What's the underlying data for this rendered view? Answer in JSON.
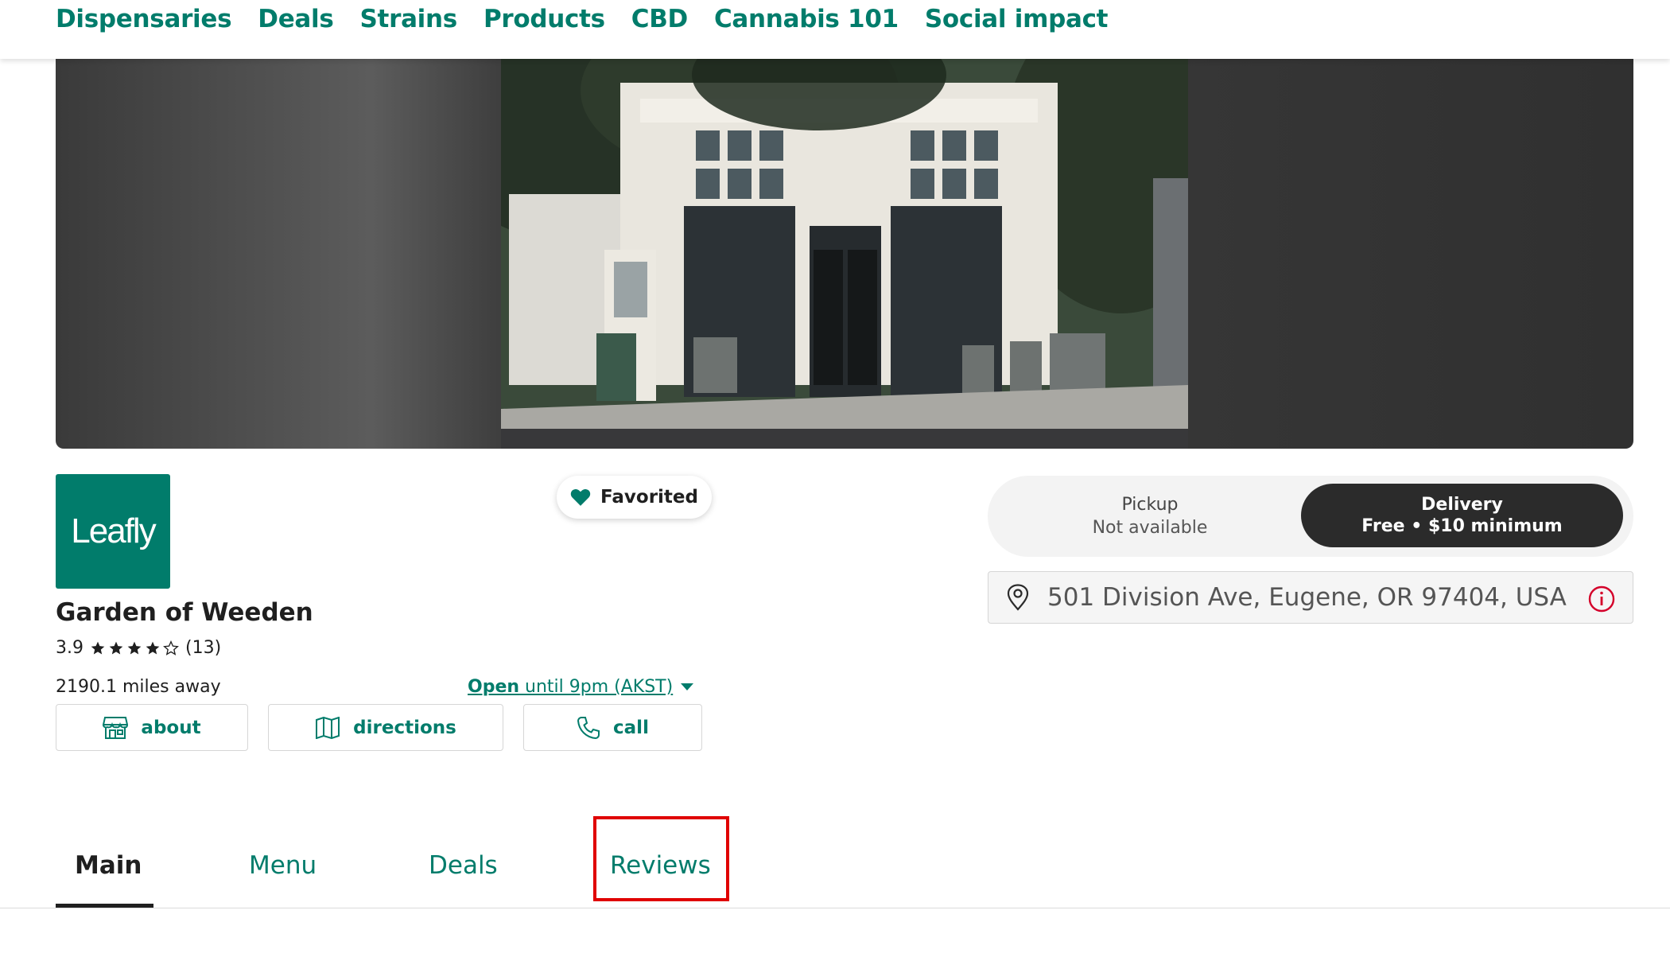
{
  "nav": {
    "items": [
      "Dispensaries",
      "Deals",
      "Strains",
      "Products",
      "CBD",
      "Cannabis 101",
      "Social impact"
    ]
  },
  "store": {
    "logo_text": "Leafly",
    "name": "Garden of Weeden",
    "rating": "3.9",
    "rating_value": 3.9,
    "review_count": "(13)",
    "distance": "2190.1 miles away",
    "status_open": "Open",
    "status_rest": " until 9pm (AKST)",
    "favorite_label": "Favorited"
  },
  "actions": {
    "about": "about",
    "directions": "directions",
    "call": "call"
  },
  "fulfillment": {
    "pickup_label": "Pickup",
    "pickup_status": "Not available",
    "delivery_label": "Delivery",
    "delivery_info": "Free • $10 minimum"
  },
  "address": "501 Division Ave, Eugene, OR 97404, USA",
  "tabs": [
    "Main",
    "Menu",
    "Deals",
    "Reviews"
  ],
  "colors": {
    "brand": "#017c6b",
    "highlight": "#e00000",
    "dark": "#2b2b2b"
  }
}
